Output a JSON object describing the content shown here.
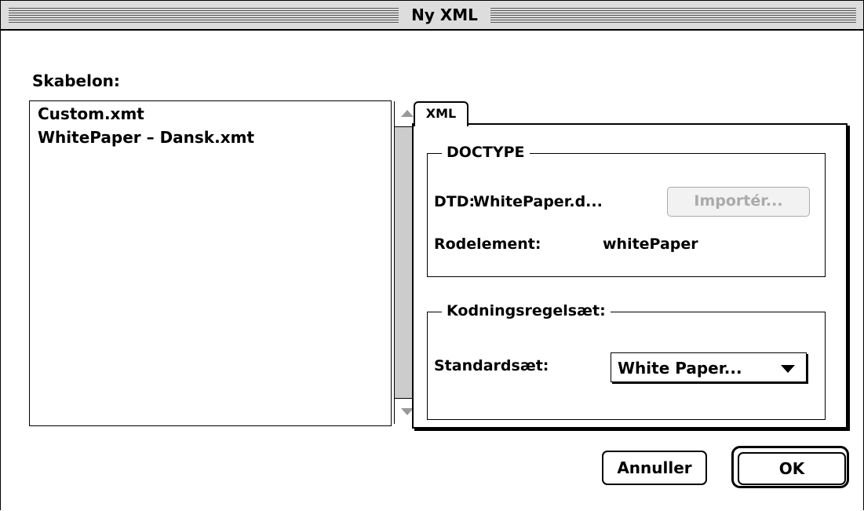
{
  "window": {
    "title": "Ny XML"
  },
  "template_section": {
    "label": "Skabelon:",
    "items": [
      "Custom.xmt",
      "WhitePaper – Dansk.xmt"
    ]
  },
  "tabs": [
    {
      "label": "XML",
      "selected": true
    }
  ],
  "doctype": {
    "group_title": "DOCTYPE",
    "dtd_label": "DTD:",
    "dtd_value": "WhitePaper.d...",
    "import_button": "Importér...",
    "root_label": "Rodelement:",
    "root_value": "whitePaper"
  },
  "encoding": {
    "group_title": "Kodningsregelsæt:",
    "standard_label": "Standardsæt:",
    "standard_value": "White Paper..."
  },
  "buttons": {
    "cancel": "Annuller",
    "ok": "OK"
  },
  "icons": {
    "scroll_up": "arrow-up-icon",
    "scroll_down": "arrow-down-icon",
    "popup": "dropdown-triangle-icon"
  }
}
